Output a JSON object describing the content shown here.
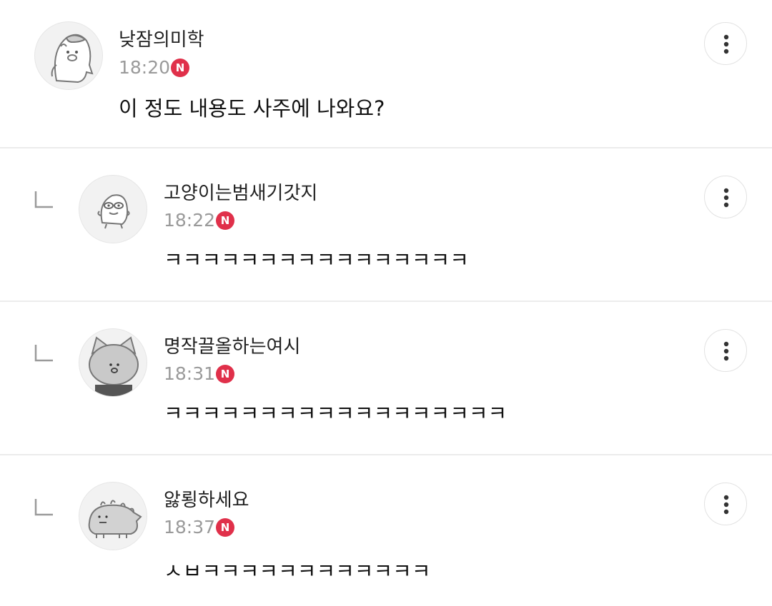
{
  "comments": [
    {
      "nickname": "낮잠의미학",
      "time": "18:20",
      "badge": "N",
      "text": "이 정도 내용도 사주에 나와요?",
      "avatar_icon": "penguin-pig-icon",
      "is_reply": false
    },
    {
      "nickname": "고양이는범새기갓지",
      "time": "18:22",
      "badge": "N",
      "text": "ㅋㅋㅋㅋㅋㅋㅋㅋㅋㅋㅋㅋㅋㅋㅋㅋ",
      "avatar_icon": "bird-character-icon",
      "is_reply": true
    },
    {
      "nickname": "명작끌올하는여시",
      "time": "18:31",
      "badge": "N",
      "text": "ㅋㅋㅋㅋㅋㅋㅋㅋㅋㅋㅋㅋㅋㅋㅋㅋㅋㅋ",
      "avatar_icon": "fox-character-icon",
      "is_reply": true
    },
    {
      "nickname": "앓룅하세요",
      "time": "18:37",
      "badge": "N",
      "text": "ㅅㅂㅋㅋㅋㅋㅋㅋㅋㅋㅋㅋㅋㅋ",
      "avatar_icon": "dinosaur-character-icon",
      "is_reply": true
    }
  ],
  "colors": {
    "badge": "#e0304a",
    "time": "#9a9a9a",
    "divider": "#ececec"
  },
  "icons": {
    "more": "more-vertical-icon",
    "reply": "reply-arrow-icon"
  }
}
